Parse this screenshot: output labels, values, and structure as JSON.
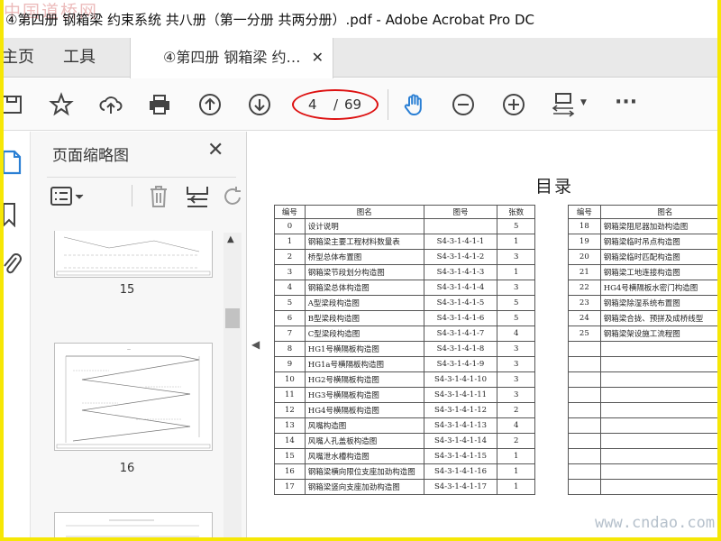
{
  "window": {
    "title": "④第四册 钢箱梁 约束系统 共八册（第一分册 共两分册）.pdf - Adobe Acrobat Pro DC",
    "watermark_top": "中国道桥网",
    "watermark_bottom": "www.cndao.com"
  },
  "tabs": {
    "home": "主页",
    "tools": "工具",
    "doc": "④第四册 钢箱梁 约…",
    "close": "✕"
  },
  "toolbar": {
    "current_page": "4",
    "separator": "/",
    "total_pages": "69",
    "more": "···"
  },
  "panel": {
    "title": "页面缩略图",
    "close": "✕",
    "thumbnails": [
      {
        "label": "15"
      },
      {
        "label": "16"
      }
    ]
  },
  "document": {
    "title": "目录",
    "headers": [
      "编号",
      "图名",
      "图号",
      "张数"
    ],
    "rows": [
      [
        "0",
        "设计说明",
        "",
        "5"
      ],
      [
        "1",
        "钢箱梁主要工程材料数量表",
        "S4-3-1-4-1-1",
        "1"
      ],
      [
        "2",
        "桥型总体布置图",
        "S4-3-1-4-1-2",
        "3"
      ],
      [
        "3",
        "钢箱梁节段划分构造图",
        "S4-3-1-4-1-3",
        "1"
      ],
      [
        "4",
        "钢箱梁总体构造图",
        "S4-3-1-4-1-4",
        "3"
      ],
      [
        "5",
        "A型梁段构造图",
        "S4-3-1-4-1-5",
        "5"
      ],
      [
        "6",
        "B型梁段构造图",
        "S4-3-1-4-1-6",
        "5"
      ],
      [
        "7",
        "C型梁段构造图",
        "S4-3-1-4-1-7",
        "4"
      ],
      [
        "8",
        "HG1号横隔板构造图",
        "S4-3-1-4-1-8",
        "3"
      ],
      [
        "9",
        "HG1a号横隔板构造图",
        "S4-3-1-4-1-9",
        "3"
      ],
      [
        "10",
        "HG2号横隔板构造图",
        "S4-3-1-4-1-10",
        "3"
      ],
      [
        "11",
        "HG3号横隔板构造图",
        "S4-3-1-4-1-11",
        "3"
      ],
      [
        "12",
        "HG4号横隔板构造图",
        "S4-3-1-4-1-12",
        "2"
      ],
      [
        "13",
        "风嘴构造图",
        "S4-3-1-4-1-13",
        "4"
      ],
      [
        "14",
        "风嘴人孔盖板构造图",
        "S4-3-1-4-1-14",
        "2"
      ],
      [
        "15",
        "风嘴泄水槽构造图",
        "S4-3-1-4-1-15",
        "1"
      ],
      [
        "16",
        "钢箱梁横向限位支座加劲构造图",
        "S4-3-1-4-1-16",
        "1"
      ],
      [
        "17",
        "钢箱梁竖向支座加劲构造图",
        "S4-3-1-4-1-17",
        "1"
      ]
    ],
    "headers2": [
      "编号",
      "图名"
    ],
    "rows2": [
      [
        "18",
        "钢箱梁阻尼器加劲构造图"
      ],
      [
        "19",
        "钢箱梁临时吊点构造图"
      ],
      [
        "20",
        "钢箱梁临时匹配构造图"
      ],
      [
        "21",
        "钢箱梁工地连接构造图"
      ],
      [
        "22",
        "HG4号横隔板水密门构造图"
      ],
      [
        "23",
        "钢箱梁除湿系统布置图"
      ],
      [
        "24",
        "钢箱梁合拢、预拼及成桥线型"
      ],
      [
        "25",
        "钢箱梁架设施工流程图"
      ],
      [
        "",
        ""
      ],
      [
        "",
        ""
      ],
      [
        "",
        ""
      ],
      [
        "",
        ""
      ],
      [
        "",
        ""
      ],
      [
        "",
        ""
      ],
      [
        "",
        ""
      ],
      [
        "",
        ""
      ],
      [
        "",
        ""
      ],
      [
        "",
        ""
      ]
    ]
  },
  "colors": {
    "border": "#f6e705",
    "annotation": "#dd1111",
    "hand_tool": "#2a7fd4"
  }
}
